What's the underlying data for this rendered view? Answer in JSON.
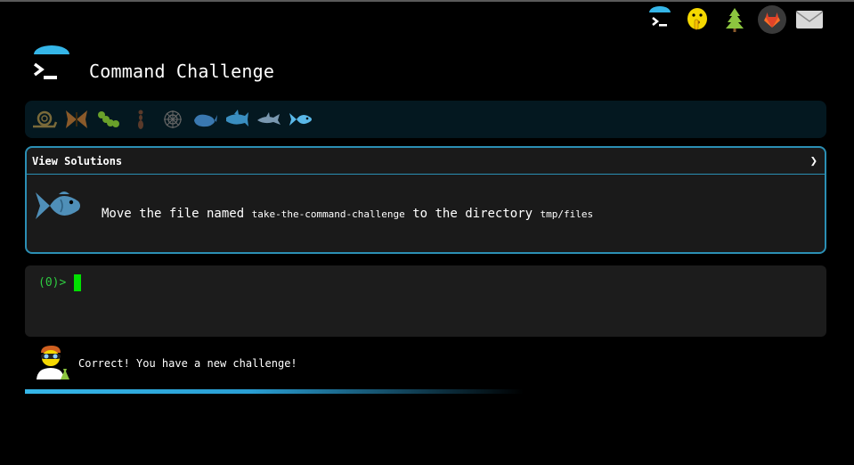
{
  "header": {
    "title": "Command Challenge"
  },
  "top_icons": [
    "terminal-icon",
    "shushing-face-icon",
    "tree-icon",
    "gitlab-icon",
    "mail-icon"
  ],
  "levels": [
    "snail-icon",
    "butterfly-icon",
    "caterpillar-icon",
    "ant-icon",
    "web-icon",
    "whale-icon",
    "shark-icon",
    "dolphin-icon",
    "fish-icon"
  ],
  "panel": {
    "heading": "View Solutions",
    "chevron": "❯",
    "task_prefix": "Move the file named",
    "task_file": "take-the-command-challenge",
    "task_middle": "to the directory",
    "task_dir": "tmp/files"
  },
  "terminal": {
    "prompt": "(0)>"
  },
  "status": {
    "message": "Correct! You have a new challenge!"
  },
  "colors": {
    "accent": "#2b8fb4",
    "prompt_green": "#2ecc40",
    "level_bar_bg": "#041820"
  }
}
